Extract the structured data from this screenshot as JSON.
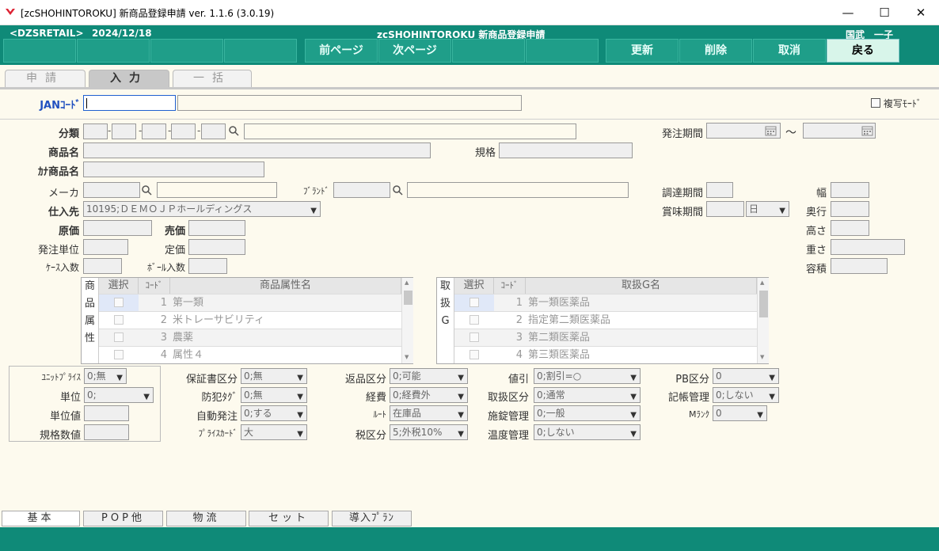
{
  "window": {
    "title": "[zcSHOHINTOROKU] 新商品登録申請 ver. 1.1.6 (3.0.19)",
    "minimize": "—",
    "maximize": "☐",
    "close": "✕"
  },
  "header": {
    "store": "<DZSRETAIL>",
    "date": "2024/12/18",
    "screen": "zcSHOHINTOROKU  新商品登録申請",
    "user": "国武　一子"
  },
  "toolbar": {
    "prev": "前ページ",
    "next": "次ページ",
    "update": "更新",
    "delete": "削除",
    "cancel": "取消",
    "back": "戻る"
  },
  "tabs": [
    "申請",
    "入力",
    "一括"
  ],
  "jan": {
    "label": "JANｺｰﾄﾞ",
    "value": ""
  },
  "copy_mode": "複写ﾓｰﾄﾞ",
  "labels": {
    "bunrui": "分類",
    "shohinmei": "商品名",
    "kana": "ｶﾅ商品名",
    "maker": "メーカ",
    "brand": "ﾌﾞﾗﾝﾄﾞ",
    "shiiresaki": "仕入先",
    "genka": "原価",
    "baika": "売価",
    "hattyu_tani": "発注単位",
    "teika": "定価",
    "case": "ｹｰｽ入数",
    "ball": "ﾎﾞｰﾙ入数",
    "kikaku": "規格",
    "hattyu_kikan": "発注期間",
    "tilde": "～",
    "chotatsu": "調達期間",
    "shomi": "賞味期間",
    "haba": "幅",
    "okuyuki": "奥行",
    "takasa": "高さ",
    "omosa": "重さ",
    "yoseki": "容積"
  },
  "shiiresaki_value": "10195;ＤＥＭＯＪＰホールディングス",
  "shomi_unit": "日",
  "attr_grid": {
    "side": [
      "商",
      "品",
      "属",
      "性"
    ],
    "headers": [
      "選択",
      "ｺｰﾄﾞ",
      "商品属性名"
    ],
    "rows": [
      {
        "code": "1",
        "name": "第一類"
      },
      {
        "code": "2",
        "name": "米トレーサビリティ"
      },
      {
        "code": "3",
        "name": "農薬"
      },
      {
        "code": "4",
        "name": "属性４"
      }
    ]
  },
  "handling_grid": {
    "side": [
      "取",
      "扱",
      "G"
    ],
    "headers": [
      "選択",
      "ｺｰﾄﾞ",
      "取扱G名"
    ],
    "rows": [
      {
        "code": "1",
        "name": "第一類医薬品"
      },
      {
        "code": "2",
        "name": "指定第二類医薬品"
      },
      {
        "code": "3",
        "name": "第二類医薬品"
      },
      {
        "code": "4",
        "name": "第三類医薬品"
      }
    ]
  },
  "unit_box": {
    "unit_price_label": "ﾕﾆｯﾄﾌﾟﾗｲｽ",
    "unit_price": "0;無",
    "tani_label": "単位",
    "tani": "0;",
    "tani_chi_label": "単位値",
    "kikaku_su_label": "規格数値"
  },
  "fields": {
    "hoshosho": {
      "label": "保証書区分",
      "value": "0;無"
    },
    "bohan": {
      "label": "防犯ﾀｸﾞ",
      "value": "0;無"
    },
    "jido": {
      "label": "自動発注",
      "value": "0;する"
    },
    "price_card": {
      "label": "ﾌﾟﾗｲｽｶｰﾄﾞ",
      "value": "大"
    },
    "henpin": {
      "label": "返品区分",
      "value": "0;可能"
    },
    "keihi": {
      "label": "経費",
      "value": "0;経費外"
    },
    "route": {
      "label": "ﾙｰﾄ",
      "value": "在庫品"
    },
    "zei": {
      "label": "税区分",
      "value": "5;外税10%"
    },
    "nebiki": {
      "label": "値引",
      "value": "0;割引=○"
    },
    "toriatsukai": {
      "label": "取扱区分",
      "value": "0;通常"
    },
    "sejo": {
      "label": "施錠管理",
      "value": "0;一般"
    },
    "ondo": {
      "label": "温度管理",
      "value": "0;しない"
    },
    "pb": {
      "label": "PB区分",
      "value": "0"
    },
    "kicho": {
      "label": "記帳管理",
      "value": "0;しない"
    },
    "mrank": {
      "label": "Mﾗﾝｸ",
      "value": "0"
    }
  },
  "bottom_tabs": [
    "基本",
    "POP他",
    "物流",
    "セット",
    "導入ﾌﾟﾗﾝ"
  ]
}
